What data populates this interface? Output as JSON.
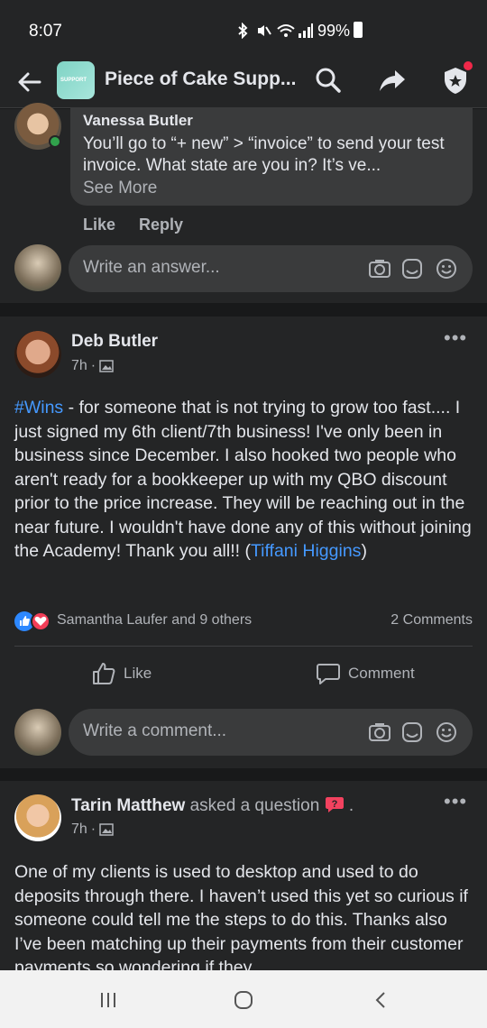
{
  "status_bar": {
    "time": "8:07",
    "battery": "99%"
  },
  "header": {
    "title": "Piece of Cake Supp...",
    "logo_text": "SUPPORT"
  },
  "comment": {
    "author": "Vanessa Butler",
    "text": "You’ll go to “+ new” > “invoice” to send your test invoice. What state are you in? It’s ve...",
    "see_more": "See More",
    "like_label": "Like",
    "reply_label": "Reply"
  },
  "answer_input": {
    "placeholder": "Write an answer..."
  },
  "post1": {
    "author": "Deb Butler",
    "time": "7h",
    "hashtag": "#Wins",
    "body": " - for someone that is not trying to grow too fast.... I just signed my 6th client/7th business! I've only been in business since December. I also hooked two people who aren't ready for a bookkeeper up with my QBO discount prior to the price increase. They will be reaching out in the near future. I wouldn't have done any of this without joining the Academy! Thank you all!! (",
    "mention": "Tiffani Higgins",
    "body_end": ")",
    "reactions_text": "Samantha Laufer and 9 others",
    "comments_count": "2 Comments",
    "like_label": "Like",
    "comment_label": "Comment",
    "comment_placeholder": "Write a comment..."
  },
  "post2": {
    "author": "Tarin Matthew",
    "asked": "asked a question",
    "trailing": ".",
    "time": "7h",
    "body": "One of my clients is used to desktop and used to do deposits through there. I haven’t used this yet so curious if someone could tell me the steps to do this. Thanks also I’ve been matching up their payments from their customer payments so wondering if they"
  },
  "colors": {
    "background": "#18191a",
    "surface": "#242526",
    "input": "#3a3b3c",
    "link": "#4599ff",
    "secondary_text": "#b0b3b8",
    "online": "#31a24c",
    "notification": "#f02849"
  }
}
